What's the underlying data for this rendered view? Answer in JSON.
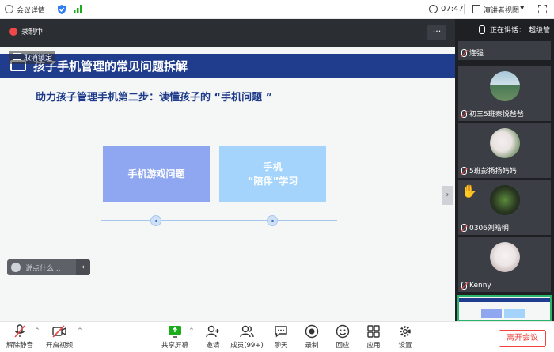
{
  "topbar": {
    "meeting_info": "会议详情",
    "time": "07:47",
    "view_mode": "演讲者视图"
  },
  "stage": {
    "recording": "录制中",
    "unlock": "取消锁定",
    "more": "···",
    "chat_placeholder": "说点什么...",
    "collapse": "‹",
    "side_toggle": "›"
  },
  "slide": {
    "title": "孩子手机管理的常见问题拆解",
    "subtitle": "助力孩子管理手机第二步：读懂孩子的 “手机问题 ”",
    "box1": "手机游戏问题",
    "box2_line1": "手机",
    "box2_line2": "“陪伴”学习"
  },
  "panel": {
    "speaking_label": "正在讲话：",
    "speaking_name": "超级管",
    "participants": [
      {
        "name": "连强"
      },
      {
        "name": "初三5班秦悦爸爸"
      },
      {
        "name": "5班彭扬扬妈妈"
      },
      {
        "name": "0306刘皓明"
      },
      {
        "name": "Kenny"
      }
    ]
  },
  "toolbar": {
    "unmute": "解除静音",
    "video": "开启视频",
    "share": "共享屏幕",
    "invite": "邀请",
    "members": "成员(99+)",
    "chat": "聊天",
    "record": "录制",
    "replay": "回应",
    "apps": "应用",
    "settings": "设置",
    "leave": "离开会议"
  },
  "colors": {
    "accent_green": "#1aad19",
    "banner_blue": "#1f3d8c",
    "leave_red": "#f0443d"
  }
}
